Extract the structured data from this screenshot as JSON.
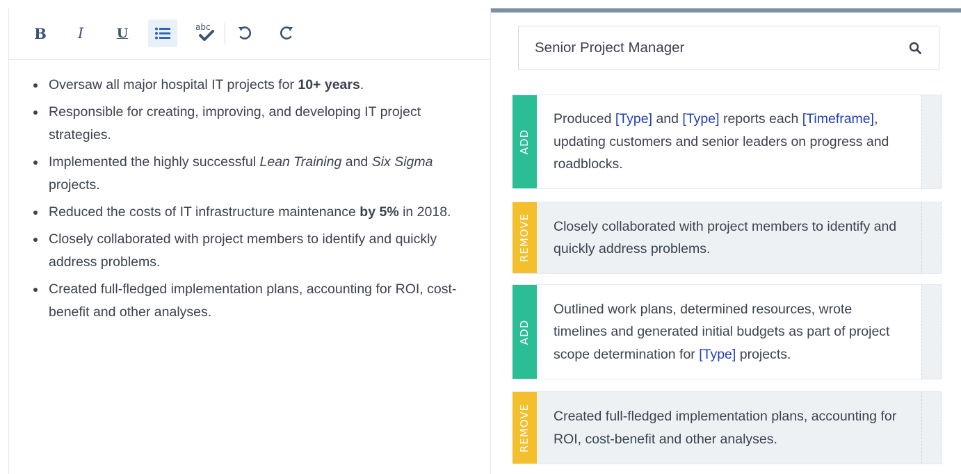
{
  "editor": {
    "toolbar": {
      "bold_label": "B",
      "italic_label": "I",
      "underline_label": "U",
      "spellcheck_label": "abc"
    },
    "bullets": [
      {
        "parts": [
          {
            "t": "Oversaw all major hospital IT projects for "
          },
          {
            "t": "10+ years",
            "b": true
          },
          {
            "t": "."
          }
        ]
      },
      {
        "parts": [
          {
            "t": "Responsible for creating, improving, and developing IT project strategies."
          }
        ]
      },
      {
        "parts": [
          {
            "t": "Implemented the highly successful "
          },
          {
            "t": "Lean Training",
            "i": true
          },
          {
            "t": " and "
          },
          {
            "t": "Six Sigma",
            "i": true
          },
          {
            "t": " projects."
          }
        ]
      },
      {
        "parts": [
          {
            "t": "Reduced the costs of IT infrastructure maintenance "
          },
          {
            "t": "by 5%",
            "b": true
          },
          {
            "t": " in 2018."
          }
        ]
      },
      {
        "parts": [
          {
            "t": "Closely collaborated with project members to identify and quickly address problems."
          }
        ]
      },
      {
        "parts": [
          {
            "t": "Created full-fledged implementation plans, accounting for ROI, cost-benefit and other analyses."
          }
        ]
      }
    ]
  },
  "search": {
    "value": "Senior Project Manager",
    "icon": "search-icon"
  },
  "suggestions": [
    {
      "action": "ADD",
      "state": "added",
      "parts": [
        {
          "t": "Produced "
        },
        {
          "t": "[Type]",
          "ph": true
        },
        {
          "t": " and "
        },
        {
          "t": "[Type]",
          "ph": true
        },
        {
          "t": " reports each "
        },
        {
          "t": "[Timeframe]",
          "ph": true
        },
        {
          "t": ", updating customers and senior leaders on progress and roadblocks."
        }
      ]
    },
    {
      "action": "REMOVE",
      "state": "removed",
      "parts": [
        {
          "t": "Closely collaborated with project members to identify and quickly address problems."
        }
      ]
    },
    {
      "action": "ADD",
      "state": "added",
      "parts": [
        {
          "t": "Outlined work plans, determined resources, wrote timelines and generated initial budgets as part of project scope determination for "
        },
        {
          "t": "[Type]",
          "ph": true
        },
        {
          "t": " projects."
        }
      ]
    },
    {
      "action": "REMOVE",
      "state": "removed",
      "parts": [
        {
          "t": "Created full-fledged implementation plans, accounting for ROI, cost-benefit and other analyses."
        }
      ]
    }
  ],
  "colors": {
    "add": "#2bbe94",
    "remove": "#f4bf2c",
    "placeholder": "#1f3fb8",
    "toolbar_icon": "#3a5276"
  }
}
